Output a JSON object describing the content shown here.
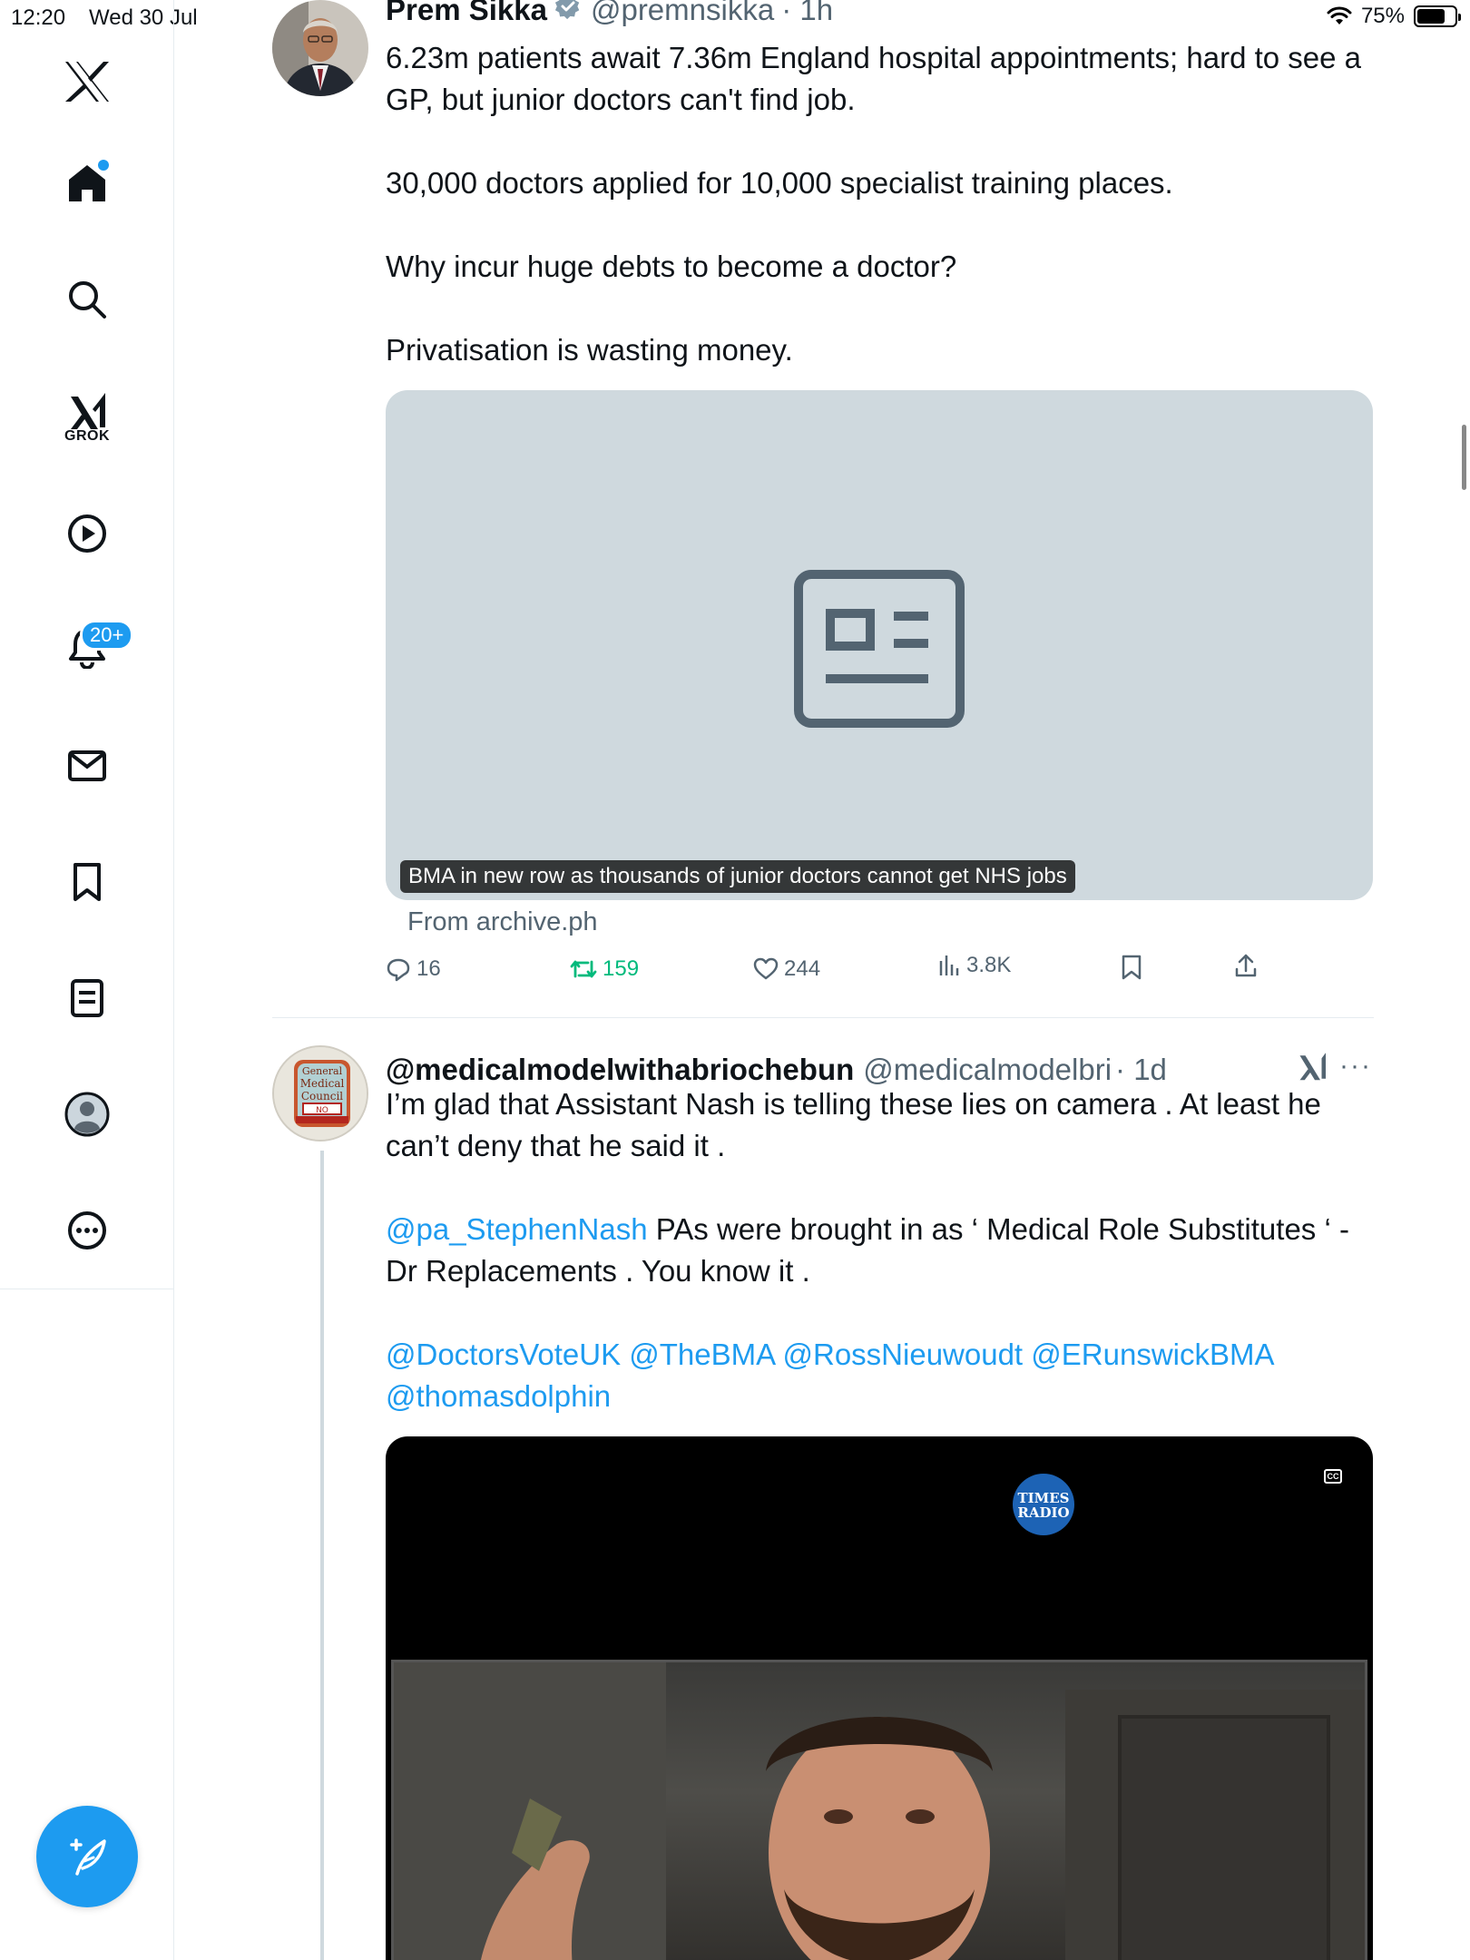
{
  "status_bar": {
    "time": "12:20",
    "date": "Wed 30 Jul",
    "battery": "75%",
    "battery_level": 0.75
  },
  "sidebar": {
    "items": [
      {
        "name": "home",
        "label": ""
      },
      {
        "name": "explore",
        "label": ""
      },
      {
        "name": "grok",
        "label": "GROK"
      },
      {
        "name": "video",
        "label": ""
      },
      {
        "name": "notifications",
        "label": ""
      },
      {
        "name": "messages",
        "label": ""
      },
      {
        "name": "bookmarks",
        "label": ""
      },
      {
        "name": "lists",
        "label": ""
      },
      {
        "name": "profile",
        "label": ""
      },
      {
        "name": "more",
        "label": ""
      }
    ],
    "notification_badge": "20+",
    "accent_color": "#1d9bf0"
  },
  "tweets": [
    {
      "display_name": "Prem Sikka",
      "handle": "@premnsikka",
      "time": "· 1h",
      "verified": true,
      "paragraphs": [
        "6.23m patients await 7.36m England  hospital appointments; hard to see a GP, but junior doctors can't find job.",
        "30,000 doctors applied for 10,000 specialist training places.",
        "Why incur huge debts to become a doctor?",
        "Privatisation is wasting money."
      ],
      "card": {
        "caption": "BMA in new row as thousands of junior doctors cannot get NHS jobs",
        "source": "From archive.ph",
        "icon": "news-article-icon"
      },
      "actions": {
        "replies": "16",
        "retweets": "159",
        "likes": "244",
        "views": "3.8K"
      }
    },
    {
      "display_name": "@medicalmodelwithabriochebun",
      "handle": "@medicalmodelbri",
      "time": "· 1d",
      "paragraphs": [
        "I’m glad that Assistant Nash is telling these lies on camera . At least he can’t deny that he said it ."
      ],
      "mention_line_1": {
        "mention": "@pa_StephenNash",
        "text": " PAs were brought in as ‘ Medical Role Substitutes ‘ - Dr Replacements . You know it ."
      },
      "mentions_line_2": "@DoctorsVoteUK @TheBMA @RossNieuwoudt @ERunswickBMA @thomasdolphin",
      "avatar_text": "General Medical Council",
      "video": {
        "cc_label": "CC",
        "watermark": "TIMES RADIO"
      }
    }
  ]
}
